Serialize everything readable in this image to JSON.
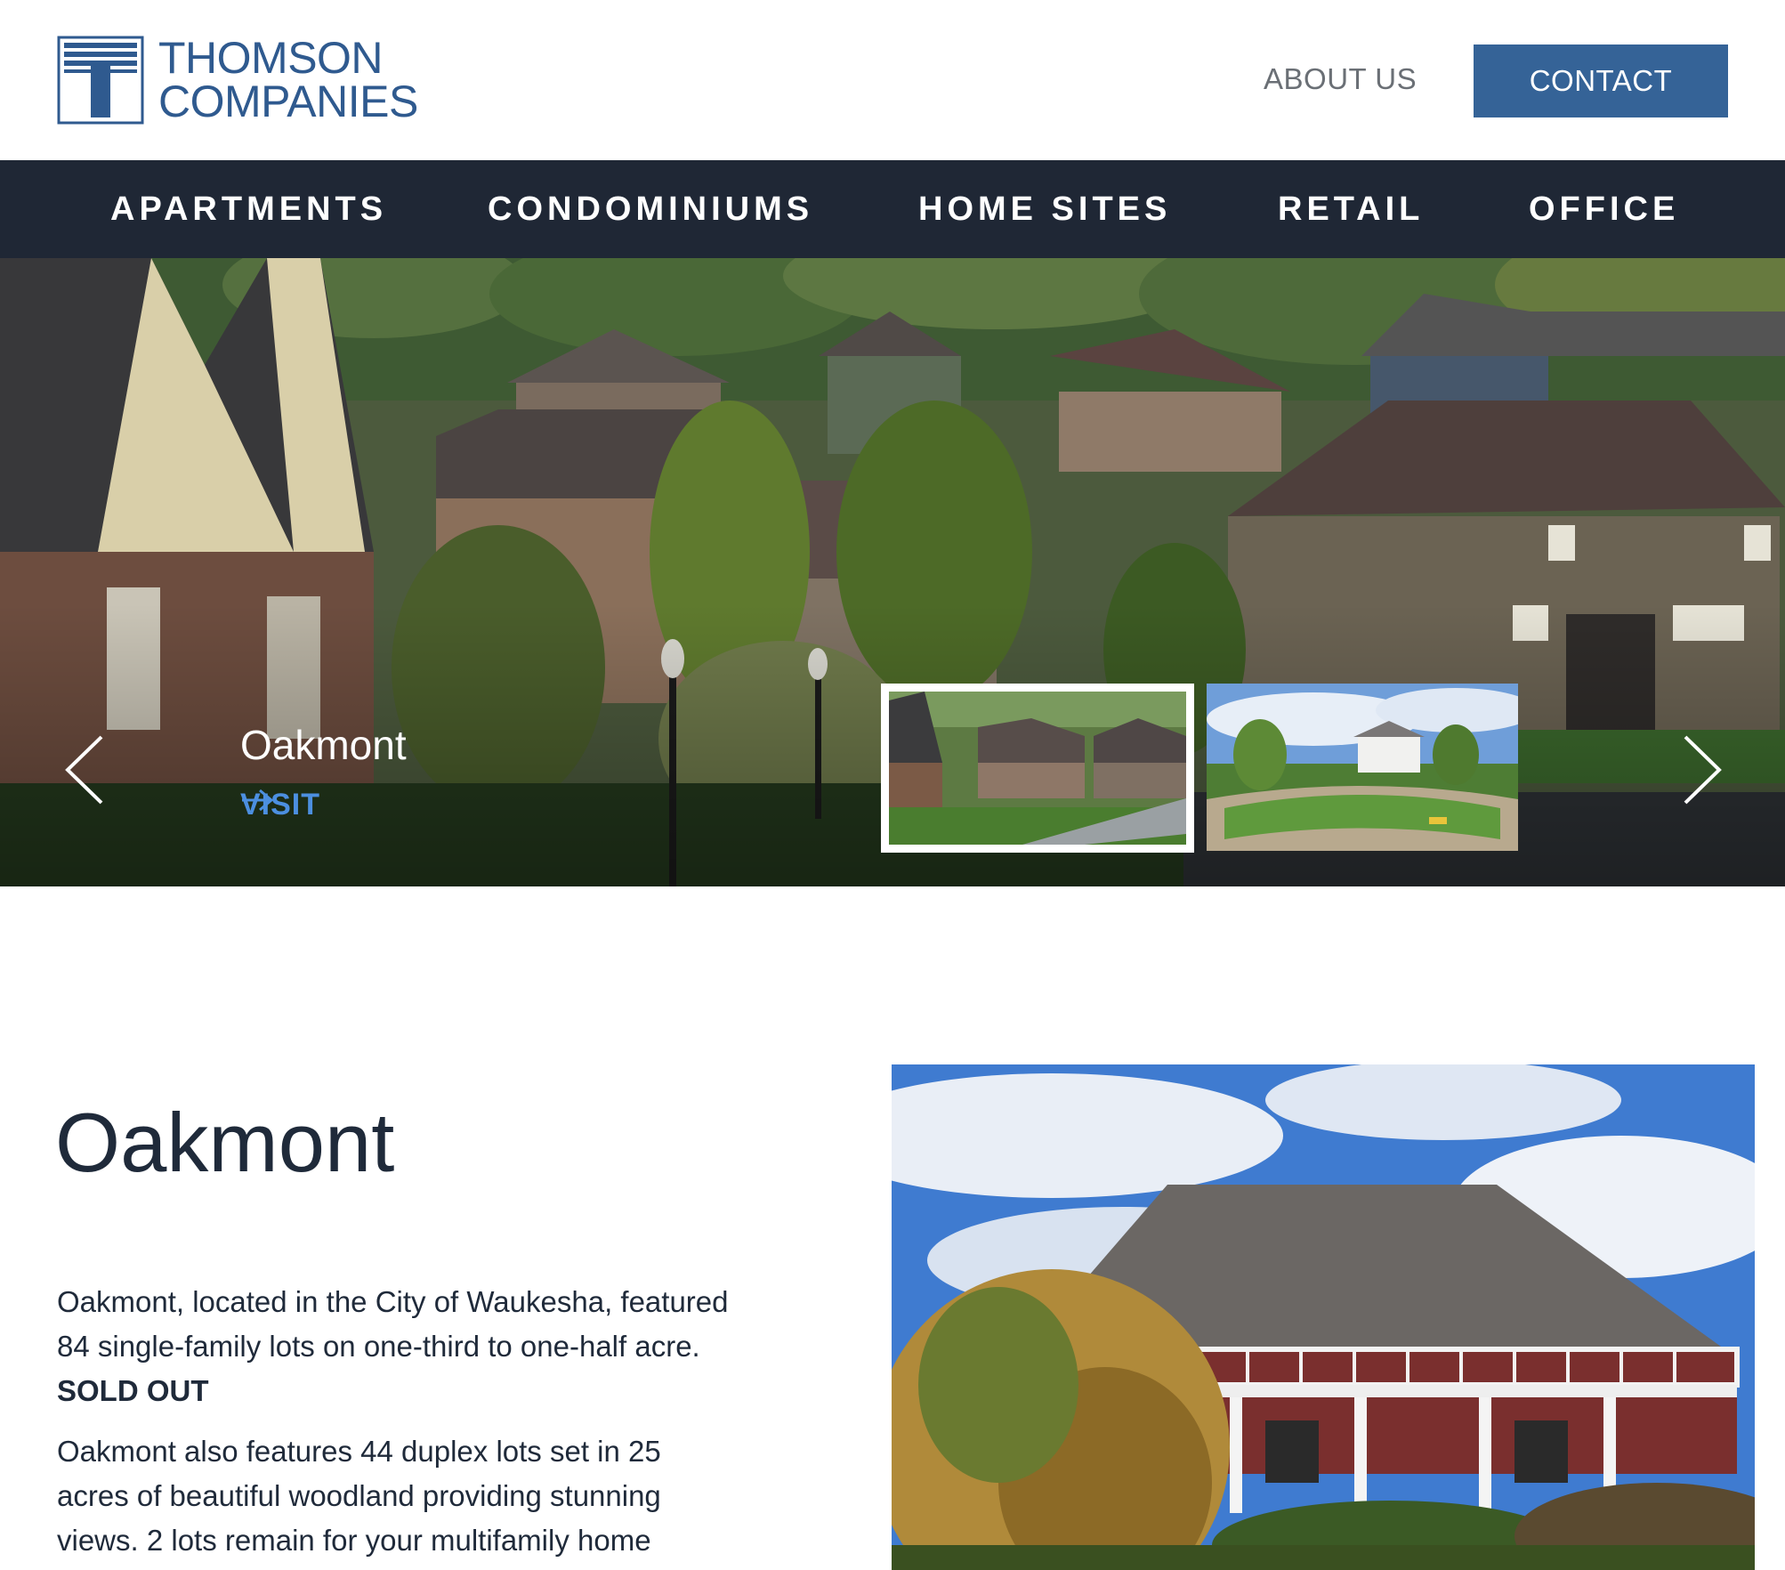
{
  "brand": {
    "logo_line1": "THOMSON",
    "logo_line2": "COMPANIES",
    "color": "#2f5a8f"
  },
  "header": {
    "about_label": "ABOUT US",
    "contact_label": "CONTACT",
    "contact_color": "#356397"
  },
  "nav": {
    "background": "#1f2735",
    "items": [
      "APARTMENTS",
      "CONDOMINIUMS",
      "HOME SITES",
      "RETAIL",
      "OFFICE"
    ]
  },
  "hero": {
    "title": "Oakmont",
    "visit_label": "VISIT",
    "prev_icon": "chevron-left-icon",
    "next_icon": "chevron-right-icon",
    "visit_icon": "arrow-right-icon"
  },
  "content": {
    "title": "Oakmont",
    "para1_text": "Oakmont, located in the City of Waukesha, featured 84 single-family lots on one-third to one-half acre.",
    "para1_bold": "SOLD OUT",
    "para2_text": "Oakmont also features 44 duplex lots set in 25 acres of beautiful woodland providing stunning views. 2 lots remain for your multifamily home"
  }
}
